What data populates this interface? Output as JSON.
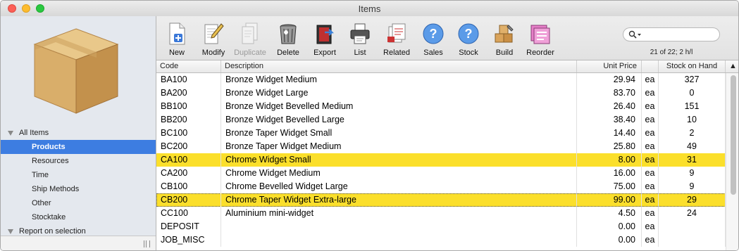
{
  "window": {
    "title": "Items"
  },
  "sidebar": {
    "group_label": "All Items",
    "items": [
      {
        "label": "Products",
        "selected": true
      },
      {
        "label": "Resources",
        "selected": false
      },
      {
        "label": "Time",
        "selected": false
      },
      {
        "label": "Ship Methods",
        "selected": false
      },
      {
        "label": "Other",
        "selected": false
      },
      {
        "label": "Stocktake",
        "selected": false
      }
    ],
    "next_group_label": "Report on selection"
  },
  "toolbar": {
    "buttons": [
      {
        "label": "New",
        "icon": "new-document-icon",
        "enabled": true
      },
      {
        "label": "Modify",
        "icon": "pencil-document-icon",
        "enabled": true
      },
      {
        "label": "Duplicate",
        "icon": "duplicate-document-icon",
        "enabled": false
      },
      {
        "label": "Delete",
        "icon": "trash-can-icon",
        "enabled": true
      },
      {
        "label": "Export",
        "icon": "export-icon",
        "enabled": true
      },
      {
        "label": "List",
        "icon": "printer-icon",
        "enabled": true
      },
      {
        "label": "Related",
        "icon": "related-icon",
        "enabled": true
      },
      {
        "label": "Sales",
        "icon": "question-icon",
        "enabled": true
      },
      {
        "label": "Stock",
        "icon": "question-icon",
        "enabled": true
      },
      {
        "label": "Build",
        "icon": "boxes-wrench-icon",
        "enabled": true
      },
      {
        "label": "Reorder",
        "icon": "reorder-icon",
        "enabled": true
      }
    ],
    "search": {
      "placeholder": ""
    },
    "record_count": "21 of 22; 2 h/l"
  },
  "table": {
    "columns": [
      "Code",
      "Description",
      "Unit Price",
      "",
      "Stock on Hand"
    ],
    "rows": [
      {
        "code": "BA100",
        "description": "Bronze Widget Medium",
        "price": "29.94",
        "unit": "ea",
        "stock": "327",
        "hl": false
      },
      {
        "code": "BA200",
        "description": "Bronze Widget Large",
        "price": "83.70",
        "unit": "ea",
        "stock": "0",
        "hl": false
      },
      {
        "code": "BB100",
        "description": "Bronze Widget Bevelled Medium",
        "price": "26.40",
        "unit": "ea",
        "stock": "151",
        "hl": false
      },
      {
        "code": "BB200",
        "description": "Bronze Widget Bevelled Large",
        "price": "38.40",
        "unit": "ea",
        "stock": "10",
        "hl": false
      },
      {
        "code": "BC100",
        "description": "Bronze Taper Widget Small",
        "price": "14.40",
        "unit": "ea",
        "stock": "2",
        "hl": false
      },
      {
        "code": "BC200",
        "description": "Bronze Taper Widget Medium",
        "price": "25.80",
        "unit": "ea",
        "stock": "49",
        "hl": false
      },
      {
        "code": "CA100",
        "description": "Chrome Widget Small",
        "price": "8.00",
        "unit": "ea",
        "stock": "31",
        "hl": true
      },
      {
        "code": "CA200",
        "description": "Chrome Widget Medium",
        "price": "16.00",
        "unit": "ea",
        "stock": "9",
        "hl": false
      },
      {
        "code": "CB100",
        "description": "Chrome Bevelled Widget Large",
        "price": "75.00",
        "unit": "ea",
        "stock": "9",
        "hl": false
      },
      {
        "code": "CB200",
        "description": "Chrome Taper Widget Extra-large",
        "price": "99.00",
        "unit": "ea",
        "stock": "29",
        "hl": true
      },
      {
        "code": "CC100",
        "description": "Aluminium mini-widget",
        "price": "4.50",
        "unit": "ea",
        "stock": "24",
        "hl": false
      },
      {
        "code": "DEPOSIT",
        "description": "",
        "price": "0.00",
        "unit": "ea",
        "stock": "",
        "hl": false
      },
      {
        "code": "JOB_MISC",
        "description": "",
        "price": "0.00",
        "unit": "ea",
        "stock": "",
        "hl": false
      }
    ]
  },
  "colors": {
    "selection_blue": "#3d7de1",
    "highlight_yellow": "#fbdf2b"
  }
}
